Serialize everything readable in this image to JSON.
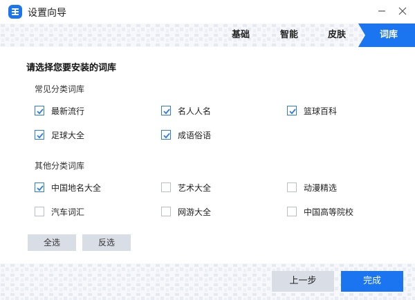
{
  "window": {
    "title": "设置向导"
  },
  "steps": [
    "基础",
    "智能",
    "皮肤",
    "词库"
  ],
  "active_step": "词库",
  "content": {
    "section_title": "请选择您要安装的词库",
    "groups": [
      {
        "title": "常见分类词库",
        "items": [
          {
            "label": "最新流行",
            "checked": true
          },
          {
            "label": "名人人名",
            "checked": true
          },
          {
            "label": "篮球百科",
            "checked": true
          },
          {
            "label": "足球大全",
            "checked": true
          },
          {
            "label": "成语俗语",
            "checked": true
          }
        ]
      },
      {
        "title": "其他分类词库",
        "items": [
          {
            "label": "中国地名大全",
            "checked": true
          },
          {
            "label": "艺术大全",
            "checked": false
          },
          {
            "label": "动漫精选",
            "checked": false
          },
          {
            "label": "汽车词汇",
            "checked": false
          },
          {
            "label": "网游大全",
            "checked": false
          },
          {
            "label": "中国高等院校",
            "checked": false
          }
        ]
      }
    ],
    "select_all": "全选",
    "invert": "反选"
  },
  "footer": {
    "prev": "上一步",
    "done": "完成"
  },
  "colors": {
    "accent": "#1b74f0",
    "button_gray": "#d8dde6",
    "pattern": "#e9edf3"
  }
}
